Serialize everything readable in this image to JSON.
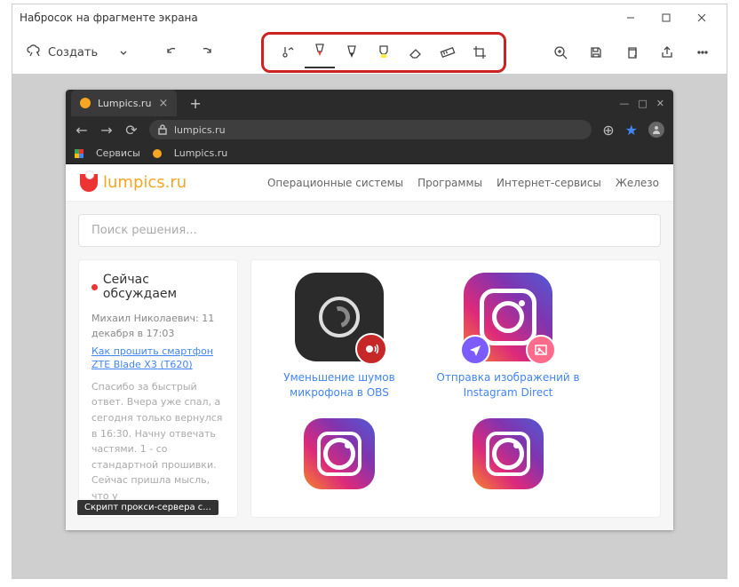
{
  "window": {
    "title": "Набросок на фрагменте экрана"
  },
  "toolbar": {
    "create": "Создать"
  },
  "browser": {
    "tab_title": "Lumpics.ru",
    "url": "lumpics.ru",
    "bookmarks": {
      "services": "Сервисы",
      "lumpics": "Lumpics.ru"
    }
  },
  "page": {
    "logo": "lumpics.ru",
    "nav": [
      "Операционные системы",
      "Программы",
      "Интернет-сервисы",
      "Железо"
    ],
    "search_placeholder": "Поиск решения...",
    "discuss": {
      "heading": "Сейчас обсуждаем",
      "author_line": "Михаил Николаевич: 11 декабря в 17:03",
      "link": "Как прошить смартфон ZTE Blade X3 (T620)",
      "body": "Спасибо за быстрый ответ. Вчера уже спал, а сегодня только вернулся в 16:30. Начну отвечать частями. 1 - со стандартной прошивки. Сейчас пришла мысль, что у"
    },
    "cards": [
      {
        "title": "Уменьшение шумов микрофона в OBS"
      },
      {
        "title": "Отправка изображений в Instagram Direct"
      }
    ],
    "tooltip": "Скрипт прокси-сервера с..."
  }
}
